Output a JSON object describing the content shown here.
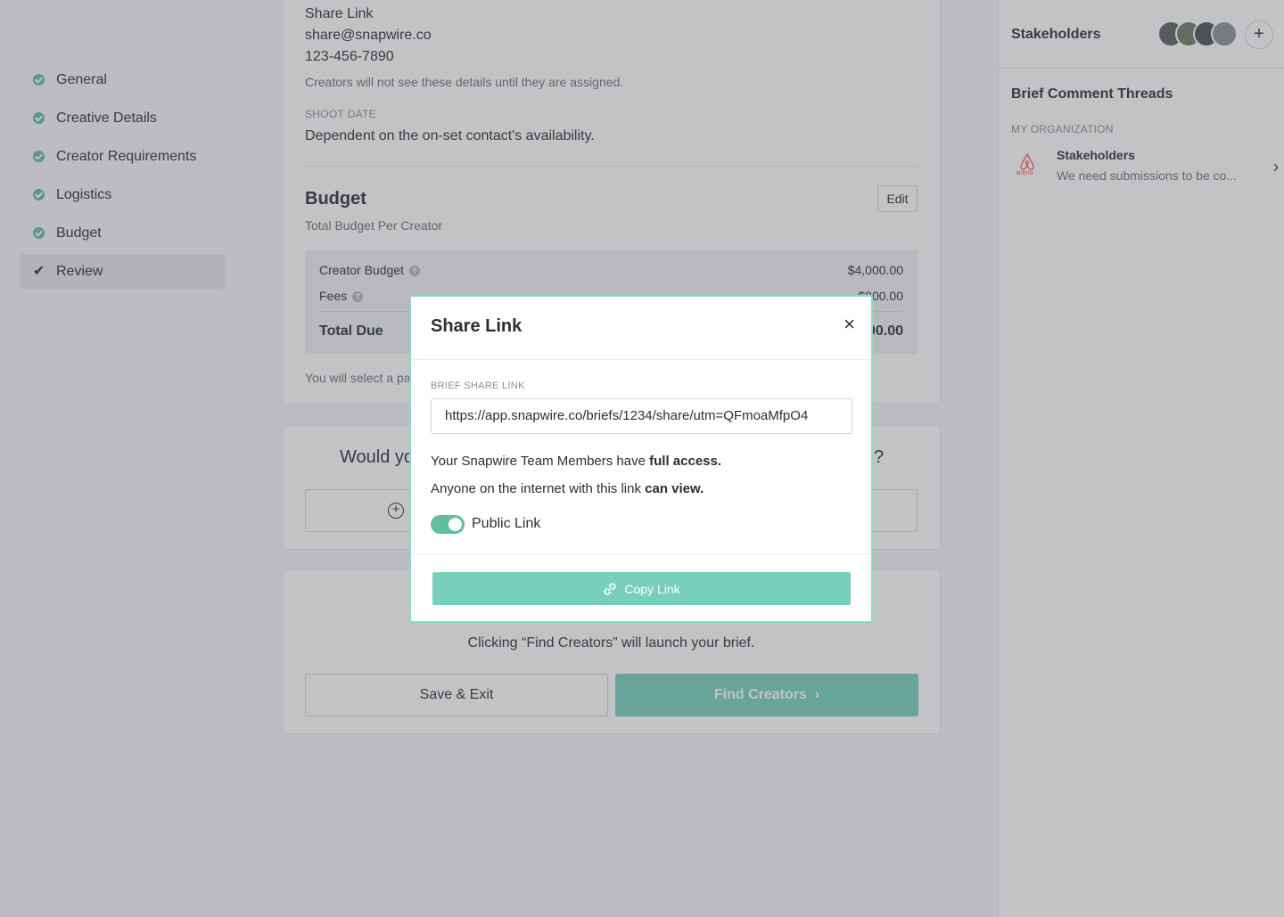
{
  "steps": [
    {
      "label": "General",
      "done": true
    },
    {
      "label": "Creative Details",
      "done": true
    },
    {
      "label": "Creator Requirements",
      "done": true
    },
    {
      "label": "Logistics",
      "done": true
    },
    {
      "label": "Budget",
      "done": true
    },
    {
      "label": "Review",
      "active": true
    }
  ],
  "contact": {
    "name": "Share Link",
    "email": "share@snapwire.co",
    "phone": "123-456-7890",
    "note": "Creators will not see these details until they are assigned."
  },
  "shoot_date": {
    "label": "SHOOT DATE",
    "value": "Dependent on the on-set contact's availability."
  },
  "budget": {
    "title": "Budget",
    "edit_label": "Edit",
    "subtitle": "Total Budget Per Creator",
    "creator_budget_label": "Creator Budget",
    "creator_budget_value": "$4,000.00",
    "fees_label": "Fees",
    "fees_value": "$800.00",
    "total_label": "Total Due",
    "total_value": "$4,800.00",
    "payment_note": "You will select a pa"
  },
  "addon": {
    "question_start": "Would yo",
    "question_end": "?"
  },
  "launch": {
    "note": "Clicking “Find Creators” will launch your brief.",
    "save_label": "Save & Exit",
    "find_label": "Find Creators"
  },
  "sidebar": {
    "stakeholders_title": "Stakeholders",
    "add_label": "+",
    "threads_title": "Brief Comment Threads",
    "org_label": "MY ORGANIZATION",
    "thread": {
      "name": "Stakeholders",
      "preview": "We need submissions to be co...",
      "logo_text": "airbnb"
    }
  },
  "modal": {
    "title": "Share Link",
    "close": "×",
    "link_label": "BRIEF SHARE LINK",
    "link_value": "https://app.snapwire.co/briefs/1234/share/utm=QFmoaMfpO4",
    "team_text": "Your Snapwire Team Members have",
    "team_bold": "full access.",
    "public_text": "Anyone on the internet with this link",
    "public_bold": "can view.",
    "toggle_label": "Public Link",
    "toggle_on": true,
    "copy_label": "Copy Link"
  },
  "colors": {
    "accent": "#5fbf9f",
    "button": "#77cfbc",
    "modal_border": "#8ad9c5",
    "brand": "#ff5a5f"
  }
}
